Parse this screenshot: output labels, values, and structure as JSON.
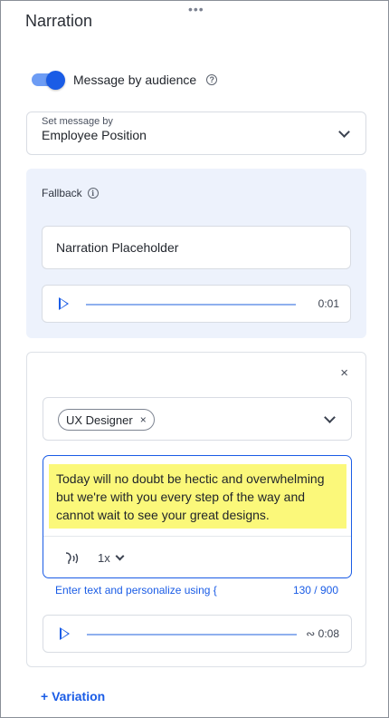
{
  "panel": {
    "title": "Narration",
    "drag_handle": "•••"
  },
  "toggle": {
    "label": "Message by audience",
    "on": true,
    "help_icon": "?"
  },
  "set_message": {
    "label": "Set message by",
    "value": "Employee Position"
  },
  "fallback": {
    "label": "Fallback",
    "info_icon": "i",
    "text": "Narration Placeholder",
    "audio_time": "0:01"
  },
  "variation": {
    "close_glyph": "×",
    "audience_chip": "UX Designer",
    "chip_remove_glyph": "×",
    "message": "Today will no doubt be hectic and overwhelming but we're with you every step of the way and cannot wait to see your great designs.",
    "speed": "1x",
    "hint": "Enter text and personalize using {",
    "counter": "130 / 900",
    "audio_time": "∾ 0:08"
  },
  "add_variation_label": "+ Variation",
  "colors": {
    "accent": "#1a5ce6",
    "highlight": "#fbf87a",
    "fallback_bg": "#edf2fc"
  }
}
